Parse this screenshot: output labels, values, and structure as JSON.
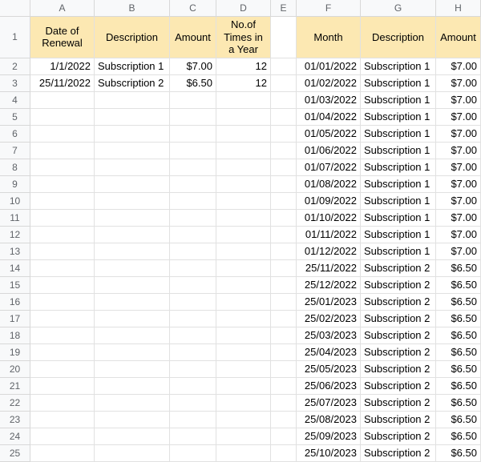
{
  "columns": [
    "A",
    "B",
    "C",
    "D",
    "E",
    "F",
    "G",
    "H"
  ],
  "row_numbers": [
    1,
    2,
    3,
    4,
    5,
    6,
    7,
    8,
    9,
    10,
    11,
    12,
    13,
    14,
    15,
    16,
    17,
    18,
    19,
    20,
    21,
    22,
    23,
    24,
    25
  ],
  "headers_left": {
    "A": "Date of Renewal",
    "B": "Description",
    "C": "Amount",
    "D": "No.of Times in a Year"
  },
  "headers_right": {
    "F": "Month",
    "G": "Description",
    "H": "Amount"
  },
  "left_data": [
    {
      "date": "1/1/2022",
      "desc": "Subscription 1",
      "amount": "$7.00",
      "times": "12"
    },
    {
      "date": "25/11/2022",
      "desc": "Subscription 2",
      "amount": "$6.50",
      "times": "12"
    }
  ],
  "right_data": [
    {
      "month": "01/01/2022",
      "desc": "Subscription 1",
      "amount": "$7.00"
    },
    {
      "month": "01/02/2022",
      "desc": "Subscription 1",
      "amount": "$7.00"
    },
    {
      "month": "01/03/2022",
      "desc": "Subscription 1",
      "amount": "$7.00"
    },
    {
      "month": "01/04/2022",
      "desc": "Subscription 1",
      "amount": "$7.00"
    },
    {
      "month": "01/05/2022",
      "desc": "Subscription 1",
      "amount": "$7.00"
    },
    {
      "month": "01/06/2022",
      "desc": "Subscription 1",
      "amount": "$7.00"
    },
    {
      "month": "01/07/2022",
      "desc": "Subscription 1",
      "amount": "$7.00"
    },
    {
      "month": "01/08/2022",
      "desc": "Subscription 1",
      "amount": "$7.00"
    },
    {
      "month": "01/09/2022",
      "desc": "Subscription 1",
      "amount": "$7.00"
    },
    {
      "month": "01/10/2022",
      "desc": "Subscription 1",
      "amount": "$7.00"
    },
    {
      "month": "01/11/2022",
      "desc": "Subscription 1",
      "amount": "$7.00"
    },
    {
      "month": "01/12/2022",
      "desc": "Subscription 1",
      "amount": "$7.00"
    },
    {
      "month": "25/11/2022",
      "desc": "Subscription 2",
      "amount": "$6.50"
    },
    {
      "month": "25/12/2022",
      "desc": "Subscription 2",
      "amount": "$6.50"
    },
    {
      "month": "25/01/2023",
      "desc": "Subscription 2",
      "amount": "$6.50"
    },
    {
      "month": "25/02/2023",
      "desc": "Subscription 2",
      "amount": "$6.50"
    },
    {
      "month": "25/03/2023",
      "desc": "Subscription 2",
      "amount": "$6.50"
    },
    {
      "month": "25/04/2023",
      "desc": "Subscription 2",
      "amount": "$6.50"
    },
    {
      "month": "25/05/2023",
      "desc": "Subscription 2",
      "amount": "$6.50"
    },
    {
      "month": "25/06/2023",
      "desc": "Subscription 2",
      "amount": "$6.50"
    },
    {
      "month": "25/07/2023",
      "desc": "Subscription 2",
      "amount": "$6.50"
    },
    {
      "month": "25/08/2023",
      "desc": "Subscription 2",
      "amount": "$6.50"
    },
    {
      "month": "25/09/2023",
      "desc": "Subscription 2",
      "amount": "$6.50"
    },
    {
      "month": "25/10/2023",
      "desc": "Subscription 2",
      "amount": "$6.50"
    }
  ]
}
